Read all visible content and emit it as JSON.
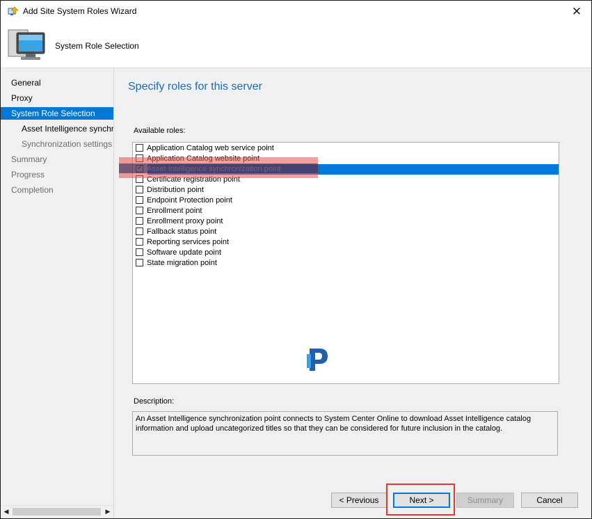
{
  "window": {
    "title": "Add Site System Roles Wizard",
    "close_glyph": "✕"
  },
  "header": {
    "title": "System Role Selection",
    "icon": "computer-icon"
  },
  "nav": {
    "items": [
      {
        "label": "General",
        "state": "normal"
      },
      {
        "label": "Proxy",
        "state": "normal"
      },
      {
        "label": "System Role Selection",
        "state": "active"
      },
      {
        "label": "Asset Intelligence synchronization point",
        "state": "sub"
      },
      {
        "label": "Synchronization settings",
        "state": "sub-dim"
      },
      {
        "label": "Summary",
        "state": "dim"
      },
      {
        "label": "Progress",
        "state": "dim"
      },
      {
        "label": "Completion",
        "state": "dim"
      }
    ],
    "scroll_left": "◀",
    "scroll_right": "▶"
  },
  "main": {
    "heading": "Specify roles for this server",
    "available_label": "Available roles:",
    "roles": [
      {
        "label": "Application Catalog web service point",
        "checked": false,
        "selected": false
      },
      {
        "label": "Application Catalog website point",
        "checked": false,
        "selected": false
      },
      {
        "label": "Asset Intelligence synchronization point",
        "checked": true,
        "selected": true
      },
      {
        "label": "Certificate registration point",
        "checked": false,
        "selected": false
      },
      {
        "label": "Distribution point",
        "checked": false,
        "selected": false
      },
      {
        "label": "Endpoint Protection point",
        "checked": false,
        "selected": false
      },
      {
        "label": "Enrollment point",
        "checked": false,
        "selected": false
      },
      {
        "label": "Enrollment proxy point",
        "checked": false,
        "selected": false
      },
      {
        "label": "Fallback status point",
        "checked": false,
        "selected": false
      },
      {
        "label": "Reporting services point",
        "checked": false,
        "selected": false
      },
      {
        "label": "Software update point",
        "checked": false,
        "selected": false
      },
      {
        "label": "State migration point",
        "checked": false,
        "selected": false
      }
    ],
    "description_label": "Description:",
    "description_text": "An Asset Intelligence synchronization point connects to System Center Online to download Asset Intelligence catalog information and upload uncategorized titles so that they can be considered for future inclusion in the catalog."
  },
  "buttons": {
    "previous": "< Previous",
    "next": "Next >",
    "summary": "Summary",
    "cancel": "Cancel"
  },
  "colors": {
    "accent": "#0078d7",
    "heading": "#1e6cb8",
    "highlight_annotation": "#e83535"
  }
}
